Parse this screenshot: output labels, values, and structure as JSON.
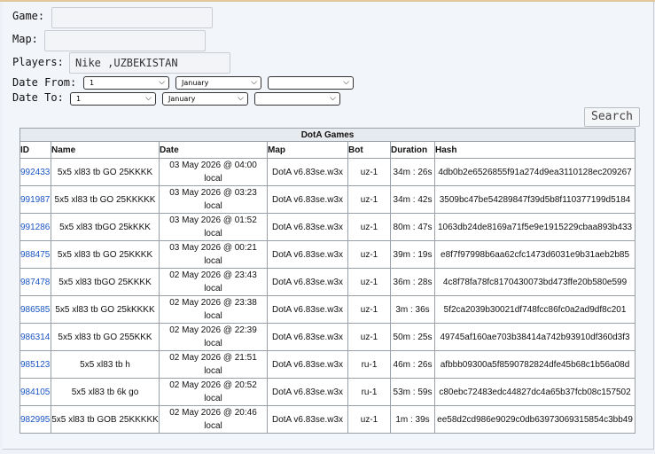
{
  "form": {
    "game_label": "Game:",
    "game_value": "",
    "map_label": "Map:",
    "map_value": "",
    "players_label": "Players:",
    "players_value": "Nike ,UZBEKISTAN",
    "date_from_label": "Date From:",
    "date_to_label": "Date To:",
    "date_from": {
      "day": "1",
      "month": "January",
      "year": ""
    },
    "date_to": {
      "day": "1",
      "month": "January",
      "year": ""
    },
    "search_label": "Search"
  },
  "table": {
    "title": "DotA Games",
    "columns": [
      "ID",
      "Name",
      "Date",
      "Map",
      "Bot",
      "Duration",
      "Hash"
    ],
    "rows": [
      {
        "id": "992433",
        "name": "5x5 xl83 tb GO 25KKKK",
        "date": "03 May 2026 @ 04:00",
        "tz": "local",
        "map": "DotA v6.83se.w3x",
        "bot": "uz-1",
        "duration": "34m : 26s",
        "hash": "4db0b2e6526855f91a274d9ea3110128ec209267"
      },
      {
        "id": "991987",
        "name": "5x5 xl83 tb GO 25KKKKK",
        "date": "03 May 2026 @ 03:23",
        "tz": "local",
        "map": "DotA v6.83se.w3x",
        "bot": "uz-1",
        "duration": "34m : 42s",
        "hash": "3509bc47be54289847f39d5b8f110377199d5184"
      },
      {
        "id": "991286",
        "name": "5x5 xl83 tbGO 25kKKK",
        "date": "03 May 2026 @ 01:52",
        "tz": "local",
        "map": "DotA v6.83se.w3x",
        "bot": "uz-1",
        "duration": "80m : 47s",
        "hash": "1063db24de8169a71f5e9e1915229cbaa893b433"
      },
      {
        "id": "988475",
        "name": "5x5 xl83 tb GO 25KKKK",
        "date": "03 May 2026 @ 00:21",
        "tz": "local",
        "map": "DotA v6.83se.w3x",
        "bot": "uz-1",
        "duration": "39m : 19s",
        "hash": "e8f7f97998b6aa62cfc1473d6031e9b31aeb2b85"
      },
      {
        "id": "987478",
        "name": "5x5 xl83 tbGO 25KKKK",
        "date": "02 May 2026 @ 23:43",
        "tz": "local",
        "map": "DotA v6.83se.w3x",
        "bot": "uz-1",
        "duration": "36m : 28s",
        "hash": "4c8f78fa78fc8170430073bd473ffe20b580e599"
      },
      {
        "id": "986585",
        "name": "5x5 xl83 tb GO 25kKKKK",
        "date": "02 May 2026 @ 23:38",
        "tz": "local",
        "map": "DotA v6.83se.w3x",
        "bot": "uz-1",
        "duration": "3m : 36s",
        "hash": "5f2ca2039b30021df748fcc86fc0a2ad9df8c201"
      },
      {
        "id": "986314",
        "name": "5x5 xl83 tb GO 255KKK",
        "date": "02 May 2026 @ 22:39",
        "tz": "local",
        "map": "DotA v6.83se.w3x",
        "bot": "uz-1",
        "duration": "50m : 25s",
        "hash": "49745af160ae703b38414a742b93910df360d3f3"
      },
      {
        "id": "985123",
        "name": "5x5 xl83 tb h",
        "date": "02 May 2026 @ 21:51",
        "tz": "local",
        "map": "DotA v6.83se.w3x",
        "bot": "ru-1",
        "duration": "46m : 26s",
        "hash": "afbbb09300a5f8590782824dfe45b68c1b56a08d"
      },
      {
        "id": "984105",
        "name": "5x5 xl83 tb 6k go",
        "date": "02 May 2026 @ 20:52",
        "tz": "local",
        "map": "DotA v6.83se.w3x",
        "bot": "ru-1",
        "duration": "53m : 59s",
        "hash": "c80ebc72483edc44827dc4a65b37fcb08c157502"
      },
      {
        "id": "982995",
        "name": "5x5 xl83 tb GOB 25KKKKK",
        "date": "02 May 2026 @ 20:46",
        "tz": "local",
        "map": "DotA v6.83se.w3x",
        "bot": "uz-1",
        "duration": "1m : 39s",
        "hash": "ee58d2cd986e9029c0db63973069315854c3bb49"
      }
    ]
  }
}
